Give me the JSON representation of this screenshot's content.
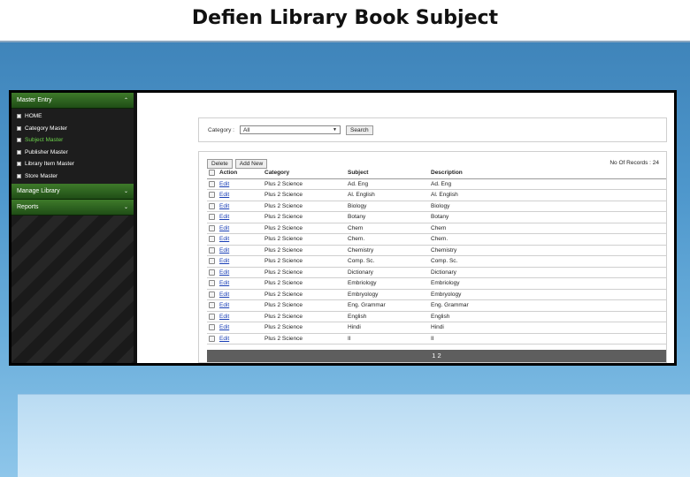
{
  "slide": {
    "title": "Defien Library Book Subject"
  },
  "sidebar": {
    "master_entry": {
      "label": "Master Entry",
      "chevron": "⌃"
    },
    "items": [
      {
        "label": "HOME",
        "icon": "book-icon",
        "active": false
      },
      {
        "label": "Category Master",
        "icon": "book-icon",
        "active": false
      },
      {
        "label": "Subject Master",
        "icon": "book-icon",
        "active": true
      },
      {
        "label": "Publisher Master",
        "icon": "book-icon",
        "active": false
      },
      {
        "label": "Library Item Master",
        "icon": "book-icon",
        "active": false
      },
      {
        "label": "Store Master",
        "icon": "book-icon",
        "active": false
      }
    ],
    "manage_library": {
      "label": "Manage Library",
      "chevron": "⌄"
    },
    "reports": {
      "label": "Reports",
      "chevron": "⌄"
    }
  },
  "search": {
    "category_label": "Category :",
    "category_value": "All",
    "search_button": "Search"
  },
  "grid": {
    "delete_button": "Delete",
    "add_new_button": "Add New",
    "records_label": "No Of Records : 24",
    "columns": [
      "Action",
      "Category",
      "Subject",
      "Description"
    ],
    "rows": [
      [
        "Edit",
        "Plus 2 Science",
        "Ad. Eng",
        "Ad. Eng"
      ],
      [
        "Edit",
        "Plus 2 Science",
        "Al. English",
        "Al. English"
      ],
      [
        "Edit",
        "Plus 2 Science",
        "Biology",
        "Biology"
      ],
      [
        "Edit",
        "Plus 2 Science",
        "Botany",
        "Botany"
      ],
      [
        "Edit",
        "Plus 2 Science",
        "Chem",
        "Chem"
      ],
      [
        "Edit",
        "Plus 2 Science",
        "Chem.",
        "Chem."
      ],
      [
        "Edit",
        "Plus 2 Science",
        "Chemistry",
        "Chemistry"
      ],
      [
        "Edit",
        "Plus 2 Science",
        "Comp. Sc.",
        "Comp. Sc."
      ],
      [
        "Edit",
        "Plus 2 Science",
        "Dictionary",
        "Dictionary"
      ],
      [
        "Edit",
        "Plus 2 Science",
        "Embriology",
        "Embriology"
      ],
      [
        "Edit",
        "Plus 2 Science",
        "Embryology",
        "Embryology"
      ],
      [
        "Edit",
        "Plus 2 Science",
        "Eng. Grammar",
        "Eng. Grammar"
      ],
      [
        "Edit",
        "Plus 2 Science",
        "English",
        "English"
      ],
      [
        "Edit",
        "Plus 2 Science",
        "Hindi",
        "Hindi"
      ],
      [
        "Edit",
        "Plus 2 Science",
        "II",
        "II"
      ]
    ],
    "pager": "1 2"
  }
}
